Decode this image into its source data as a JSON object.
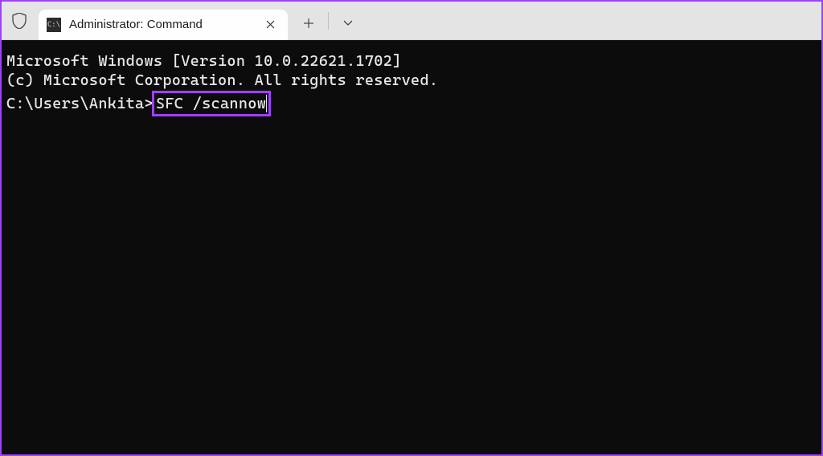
{
  "titlebar": {
    "tab_title": "Administrator: Command",
    "tab_icon_glyph": "C:\\",
    "new_tab_label": "+",
    "dropdown_label": "⌄"
  },
  "terminal": {
    "line1": "Microsoft Windows [Version 10.0.22621.1702]",
    "line2": "(c) Microsoft Corporation. All rights reserved.",
    "blank": "",
    "prompt": "C:\\Users\\Ankita>",
    "command": "SFC /scannow"
  },
  "colors": {
    "highlight": "#a040ff",
    "terminal_bg": "#0c0c0c",
    "terminal_fg": "#e8e8e8"
  }
}
